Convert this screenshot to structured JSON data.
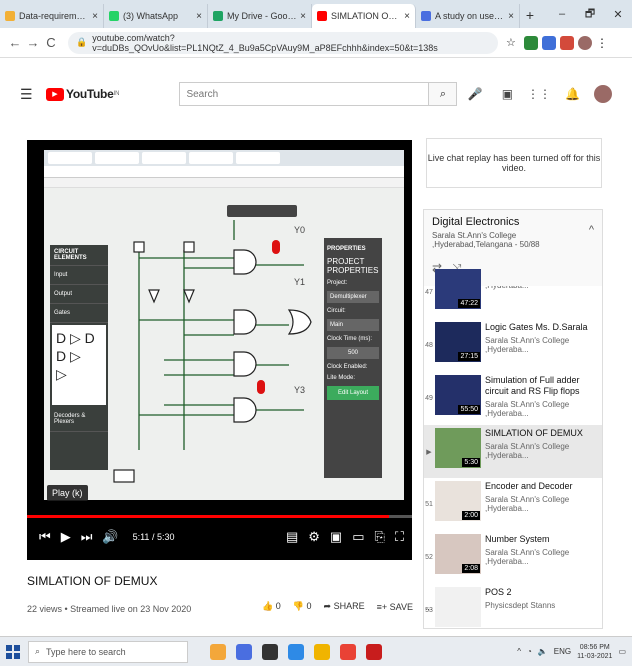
{
  "browser": {
    "tabs": [
      {
        "label": "Data-requirement-Website",
        "color": "#f2b036",
        "active": false
      },
      {
        "label": "(3) WhatsApp",
        "color": "#25d366",
        "active": false
      },
      {
        "label": "My Drive - Google Drive",
        "color": "#1fa463",
        "active": false
      },
      {
        "label": "SIMLATION OF DEMUX - YouT",
        "color": "#ff0000",
        "active": true
      },
      {
        "label": "A study on useful technologie",
        "color": "#4a6ee0",
        "active": false
      }
    ],
    "new_tab": "+",
    "url": "youtube.com/watch?v=duDBs_QOvUo&list=PL1NQtZ_4_Bu9a5CpVAuy9M_aP8EFchhh&index=50&t=138s",
    "window_controls": [
      "–",
      "🗗",
      "✕"
    ]
  },
  "youtube": {
    "logo_text": "YouTube",
    "logo_country": "IN",
    "search_placeholder": "Search"
  },
  "player": {
    "time": "5:11 / 5:30",
    "progress": 0.94,
    "tooltip": "Play (k)",
    "screen": {
      "panel_title": "CIRCUIT ELEMENTS",
      "panel_items": [
        "Input",
        "Output",
        "Gates",
        "Decoders & Plexers"
      ],
      "props_title": "PROPERTIES",
      "props_sub": "PROJECT PROPERTIES",
      "project_label": "Project:",
      "project_value": "Demultiplexer",
      "circuit_label": "Circuit:",
      "circuit_value": "Main",
      "clock_label": "Clock Time (ms):",
      "clock_value": "500",
      "clock_enabled": "Clock Enabled:",
      "lite_mode": "Lite Mode:",
      "edit_layout": "Edit Layout",
      "outputs": [
        "Y0",
        "Y1",
        "Y2",
        "Y3"
      ]
    }
  },
  "video": {
    "title": "SIMLATION OF DEMUX",
    "meta": "22 views • Streamed live on 23 Nov 2020",
    "likes": "0",
    "dislikes": "0",
    "share": "SHARE",
    "save": "SAVE",
    "more": "..."
  },
  "chat": {
    "message": "Live chat replay has been turned off for this video."
  },
  "playlist": {
    "title": "Digital Electronics",
    "subtitle": "Sarala St.Ann's College ,Hyderabad,Telangana - 50/88",
    "items": [
      {
        "index": "47",
        "title": "",
        "channel": "Sarala St.Ann's College ,Hyderaba...",
        "duration": "47:22",
        "thumb": "#2b3a7a",
        "current": false
      },
      {
        "index": "48",
        "title": "Logic Gates Ms. D.Sarala",
        "channel": "Sarala St.Ann's College ,Hyderaba...",
        "duration": "27:15",
        "thumb": "#1d2a5c",
        "current": false
      },
      {
        "index": "49",
        "title": "Simulation of Full adder circuit and RS Flip flops",
        "channel": "Sarala St.Ann's College ,Hyderaba...",
        "duration": "55:50",
        "thumb": "#24306a",
        "current": false
      },
      {
        "index": "▶",
        "title": "SIMLATION OF DEMUX",
        "channel": "Sarala St.Ann's College ,Hyderaba...",
        "duration": "5:30",
        "thumb": "#6f9b5b",
        "current": true
      },
      {
        "index": "51",
        "title": "Encoder and Decoder",
        "channel": "Sarala St.Ann's College ,Hyderaba...",
        "duration": "2:00",
        "thumb": "#e9e2dc",
        "current": false
      },
      {
        "index": "52",
        "title": "Number System",
        "channel": "Sarala St.Ann's College ,Hyderaba...",
        "duration": "2:08",
        "thumb": "#d7c7c0",
        "current": false
      },
      {
        "index": "53",
        "title": "POS 2",
        "channel": "Physicsdept Stanns",
        "duration": "",
        "thumb": "#f1f1f1",
        "current": false
      }
    ]
  },
  "taskbar": {
    "search_placeholder": "Type here to search",
    "apps": [
      "#f3a73b",
      "#4a6ee0",
      "#333333",
      "#2e8ae6",
      "#f0b400",
      "#e94235",
      "#c81d1d"
    ],
    "lang": "ENG",
    "time": "08:56 PM",
    "date": "11-03-2021"
  }
}
